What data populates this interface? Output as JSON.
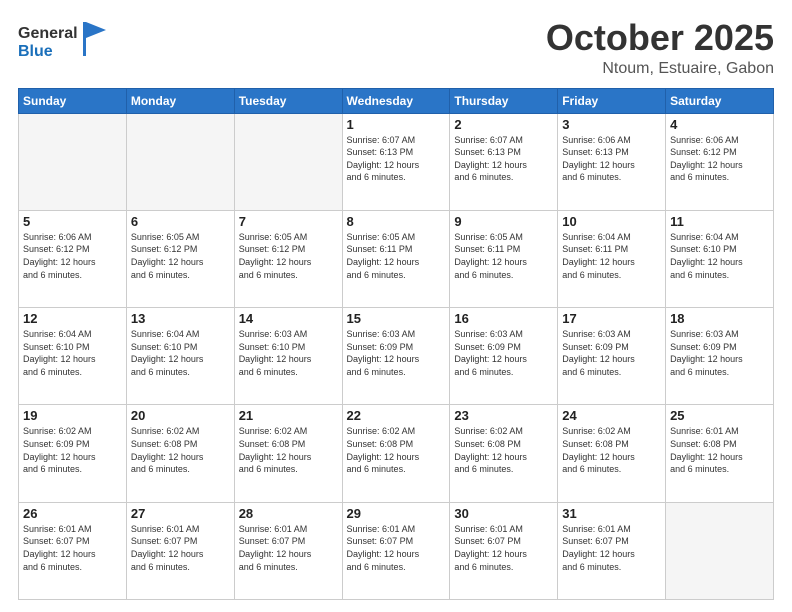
{
  "header": {
    "logo_line1": "General",
    "logo_line2": "Blue",
    "month": "October 2025",
    "location": "Ntoum, Estuaire, Gabon"
  },
  "weekdays": [
    "Sunday",
    "Monday",
    "Tuesday",
    "Wednesday",
    "Thursday",
    "Friday",
    "Saturday"
  ],
  "weeks": [
    [
      {
        "day": "",
        "info": ""
      },
      {
        "day": "",
        "info": ""
      },
      {
        "day": "",
        "info": ""
      },
      {
        "day": "1",
        "info": "Sunrise: 6:07 AM\nSunset: 6:13 PM\nDaylight: 12 hours\nand 6 minutes."
      },
      {
        "day": "2",
        "info": "Sunrise: 6:07 AM\nSunset: 6:13 PM\nDaylight: 12 hours\nand 6 minutes."
      },
      {
        "day": "3",
        "info": "Sunrise: 6:06 AM\nSunset: 6:13 PM\nDaylight: 12 hours\nand 6 minutes."
      },
      {
        "day": "4",
        "info": "Sunrise: 6:06 AM\nSunset: 6:12 PM\nDaylight: 12 hours\nand 6 minutes."
      }
    ],
    [
      {
        "day": "5",
        "info": "Sunrise: 6:06 AM\nSunset: 6:12 PM\nDaylight: 12 hours\nand 6 minutes."
      },
      {
        "day": "6",
        "info": "Sunrise: 6:05 AM\nSunset: 6:12 PM\nDaylight: 12 hours\nand 6 minutes."
      },
      {
        "day": "7",
        "info": "Sunrise: 6:05 AM\nSunset: 6:12 PM\nDaylight: 12 hours\nand 6 minutes."
      },
      {
        "day": "8",
        "info": "Sunrise: 6:05 AM\nSunset: 6:11 PM\nDaylight: 12 hours\nand 6 minutes."
      },
      {
        "day": "9",
        "info": "Sunrise: 6:05 AM\nSunset: 6:11 PM\nDaylight: 12 hours\nand 6 minutes."
      },
      {
        "day": "10",
        "info": "Sunrise: 6:04 AM\nSunset: 6:11 PM\nDaylight: 12 hours\nand 6 minutes."
      },
      {
        "day": "11",
        "info": "Sunrise: 6:04 AM\nSunset: 6:10 PM\nDaylight: 12 hours\nand 6 minutes."
      }
    ],
    [
      {
        "day": "12",
        "info": "Sunrise: 6:04 AM\nSunset: 6:10 PM\nDaylight: 12 hours\nand 6 minutes."
      },
      {
        "day": "13",
        "info": "Sunrise: 6:04 AM\nSunset: 6:10 PM\nDaylight: 12 hours\nand 6 minutes."
      },
      {
        "day": "14",
        "info": "Sunrise: 6:03 AM\nSunset: 6:10 PM\nDaylight: 12 hours\nand 6 minutes."
      },
      {
        "day": "15",
        "info": "Sunrise: 6:03 AM\nSunset: 6:09 PM\nDaylight: 12 hours\nand 6 minutes."
      },
      {
        "day": "16",
        "info": "Sunrise: 6:03 AM\nSunset: 6:09 PM\nDaylight: 12 hours\nand 6 minutes."
      },
      {
        "day": "17",
        "info": "Sunrise: 6:03 AM\nSunset: 6:09 PM\nDaylight: 12 hours\nand 6 minutes."
      },
      {
        "day": "18",
        "info": "Sunrise: 6:03 AM\nSunset: 6:09 PM\nDaylight: 12 hours\nand 6 minutes."
      }
    ],
    [
      {
        "day": "19",
        "info": "Sunrise: 6:02 AM\nSunset: 6:09 PM\nDaylight: 12 hours\nand 6 minutes."
      },
      {
        "day": "20",
        "info": "Sunrise: 6:02 AM\nSunset: 6:08 PM\nDaylight: 12 hours\nand 6 minutes."
      },
      {
        "day": "21",
        "info": "Sunrise: 6:02 AM\nSunset: 6:08 PM\nDaylight: 12 hours\nand 6 minutes."
      },
      {
        "day": "22",
        "info": "Sunrise: 6:02 AM\nSunset: 6:08 PM\nDaylight: 12 hours\nand 6 minutes."
      },
      {
        "day": "23",
        "info": "Sunrise: 6:02 AM\nSunset: 6:08 PM\nDaylight: 12 hours\nand 6 minutes."
      },
      {
        "day": "24",
        "info": "Sunrise: 6:02 AM\nSunset: 6:08 PM\nDaylight: 12 hours\nand 6 minutes."
      },
      {
        "day": "25",
        "info": "Sunrise: 6:01 AM\nSunset: 6:08 PM\nDaylight: 12 hours\nand 6 minutes."
      }
    ],
    [
      {
        "day": "26",
        "info": "Sunrise: 6:01 AM\nSunset: 6:07 PM\nDaylight: 12 hours\nand 6 minutes."
      },
      {
        "day": "27",
        "info": "Sunrise: 6:01 AM\nSunset: 6:07 PM\nDaylight: 12 hours\nand 6 minutes."
      },
      {
        "day": "28",
        "info": "Sunrise: 6:01 AM\nSunset: 6:07 PM\nDaylight: 12 hours\nand 6 minutes."
      },
      {
        "day": "29",
        "info": "Sunrise: 6:01 AM\nSunset: 6:07 PM\nDaylight: 12 hours\nand 6 minutes."
      },
      {
        "day": "30",
        "info": "Sunrise: 6:01 AM\nSunset: 6:07 PM\nDaylight: 12 hours\nand 6 minutes."
      },
      {
        "day": "31",
        "info": "Sunrise: 6:01 AM\nSunset: 6:07 PM\nDaylight: 12 hours\nand 6 minutes."
      },
      {
        "day": "",
        "info": ""
      }
    ]
  ]
}
